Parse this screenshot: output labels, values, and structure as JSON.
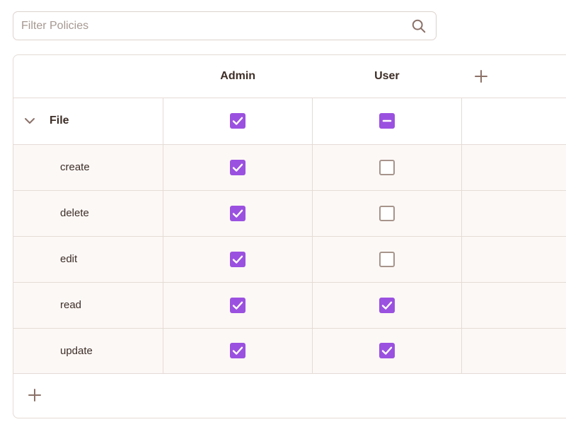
{
  "filter": {
    "placeholder": "Filter Policies",
    "value": ""
  },
  "columns": [
    {
      "label": "Admin"
    },
    {
      "label": "User"
    }
  ],
  "icons": {
    "search": "search-icon",
    "add_column": "plus-icon",
    "add_row": "plus-icon",
    "collapse": "chevron-down-icon"
  },
  "colors": {
    "accent": "#9b51e0",
    "row_bg": "#fcf8f6",
    "border": "#e4dbd5",
    "icon": "#8b7168"
  },
  "group": {
    "label": "File",
    "expanded": true,
    "admin": "checked",
    "user": "indeterminate"
  },
  "permissions": [
    {
      "label": "create",
      "admin": "checked",
      "user": "unchecked"
    },
    {
      "label": "delete",
      "admin": "checked",
      "user": "unchecked"
    },
    {
      "label": "edit",
      "admin": "checked",
      "user": "unchecked"
    },
    {
      "label": "read",
      "admin": "checked",
      "user": "checked"
    },
    {
      "label": "update",
      "admin": "checked",
      "user": "checked"
    }
  ]
}
